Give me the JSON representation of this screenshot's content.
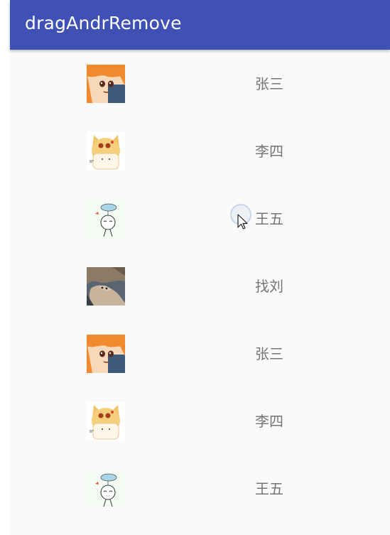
{
  "app_bar": {
    "title": "dragAndrRemove",
    "color": "#3f51b5"
  },
  "list": {
    "items": [
      {
        "avatar": "umaru-avatar",
        "name": "张三"
      },
      {
        "avatar": "cat-girl-avatar",
        "name": "李四"
      },
      {
        "avatar": "cloud-doodle-avatar",
        "name": "王五"
      },
      {
        "avatar": "cat-photo-avatar",
        "name": "找刘"
      },
      {
        "avatar": "umaru-avatar",
        "name": "张三"
      },
      {
        "avatar": "cat-girl-avatar",
        "name": "李四"
      },
      {
        "avatar": "cloud-doodle-avatar",
        "name": "王五"
      }
    ]
  }
}
